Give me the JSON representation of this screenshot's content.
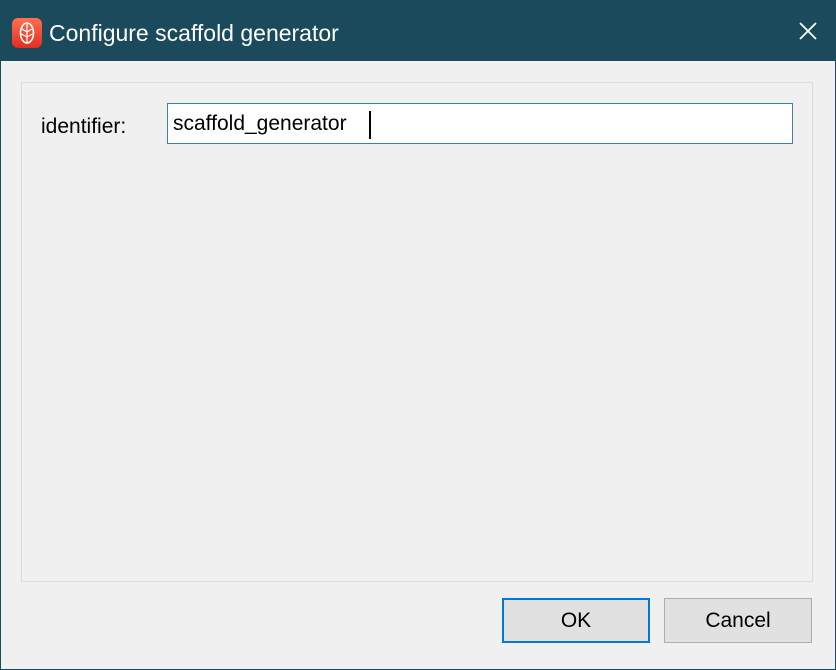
{
  "window": {
    "title": "Configure scaffold generator",
    "icon": "app-logo-icon",
    "titlebar_color": "#1a4a5c",
    "close_icon": "close-icon"
  },
  "form": {
    "identifier_label": "identifier:",
    "identifier_value": "scaffold_generator"
  },
  "buttons": {
    "ok_label": "OK",
    "cancel_label": "Cancel",
    "default_accent": "#0078d7"
  }
}
